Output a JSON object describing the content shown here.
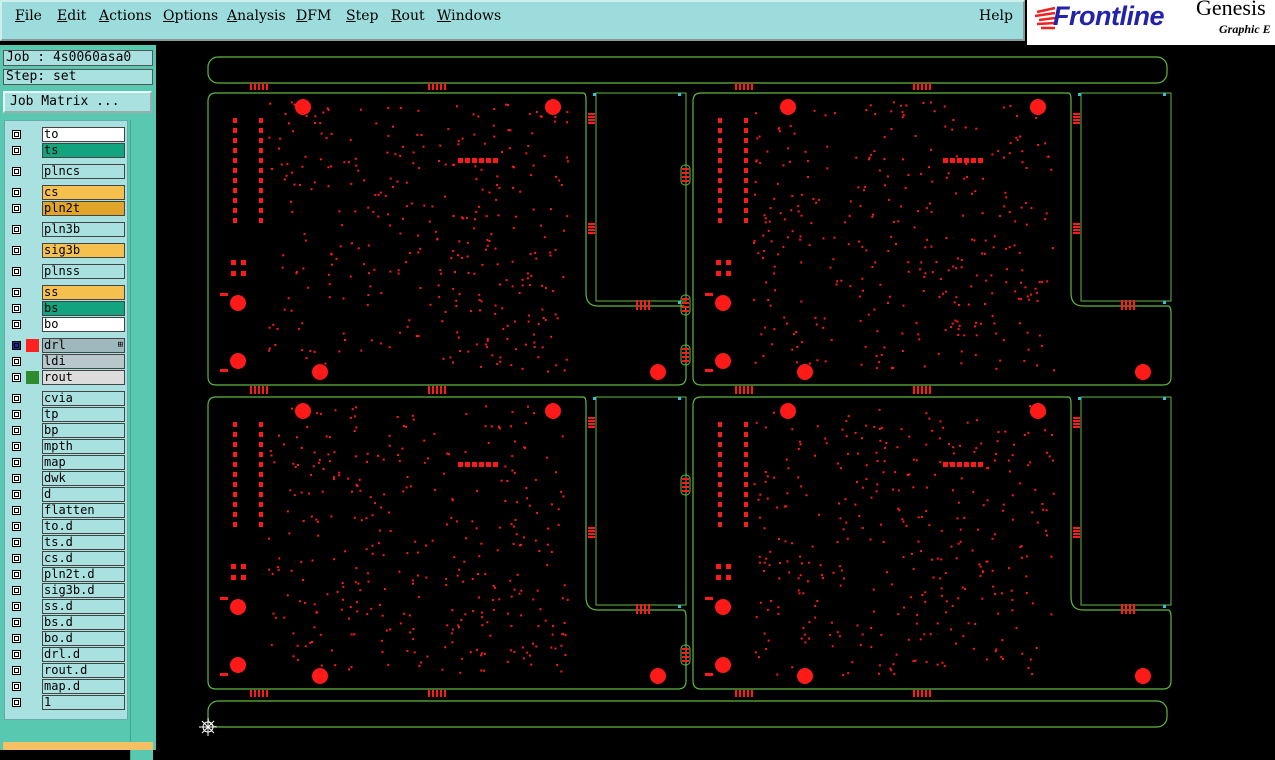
{
  "menu": {
    "items": [
      {
        "label": "File",
        "key": "F",
        "rest": "ile"
      },
      {
        "label": "Edit",
        "key": "E",
        "rest": "dit"
      },
      {
        "label": "Actions",
        "key": "A",
        "rest": "ctions"
      },
      {
        "label": "Options",
        "key": "O",
        "rest": "ptions"
      },
      {
        "label": "Analysis",
        "key": "A",
        "rest": "nalysis"
      },
      {
        "label": "DFM",
        "key": "D",
        "rest": "FM"
      },
      {
        "label": "Step",
        "key": "S",
        "rest": "tep"
      },
      {
        "label": "Rout",
        "key": "R",
        "rest": "out"
      },
      {
        "label": "Windows",
        "key": "W",
        "rest": "indows"
      }
    ],
    "help": "Help"
  },
  "logo": {
    "brand": "Frontline",
    "product": "Genesis",
    "subtitle": "Graphic E"
  },
  "job": {
    "label": "Job : 4s0060asa0",
    "step": "Step: set",
    "matrix_button": "Job Matrix ..."
  },
  "layers": [
    {
      "name": "to",
      "color": "#ffffff"
    },
    {
      "name": "ts",
      "color": "#13a37e"
    },
    {
      "name": "plncs",
      "color": "#a9e0e0"
    },
    {
      "name": "cs",
      "color": "#f6c04f"
    },
    {
      "name": "pln2t",
      "color": "#e0a52a"
    },
    {
      "name": "pln3b",
      "color": "#a9e0e0"
    },
    {
      "name": "sig3b",
      "color": "#f6c04f"
    },
    {
      "name": "plnss",
      "color": "#a9e0e0"
    },
    {
      "name": "ss",
      "color": "#f6c04f"
    },
    {
      "name": "bs",
      "color": "#13a37e"
    },
    {
      "name": "bo",
      "color": "#ffffff"
    },
    {
      "name": "drl",
      "color": "#9fb8bc",
      "swatch": "#ff2020",
      "active": true
    },
    {
      "name": "ldi",
      "color": "#b8c8ca"
    },
    {
      "name": "rout",
      "color": "#dcdcdc",
      "swatch": "#2e8b2e"
    },
    {
      "name": "cvia",
      "color": "#a9e0e0"
    },
    {
      "name": "tp",
      "color": "#a9e0e0"
    },
    {
      "name": "bp",
      "color": "#a9e0e0"
    },
    {
      "name": "mpth",
      "color": "#a9e0e0"
    },
    {
      "name": "map",
      "color": "#a9e0e0"
    },
    {
      "name": "dwk",
      "color": "#a9e0e0"
    },
    {
      "name": "d",
      "color": "#a9e0e0"
    },
    {
      "name": "flatten",
      "color": "#a9e0e0"
    },
    {
      "name": "to.d",
      "color": "#a9e0e0"
    },
    {
      "name": "ts.d",
      "color": "#a9e0e0"
    },
    {
      "name": "cs.d",
      "color": "#a9e0e0"
    },
    {
      "name": "pln2t.d",
      "color": "#a9e0e0"
    },
    {
      "name": "sig3b.d",
      "color": "#a9e0e0"
    },
    {
      "name": "ss.d",
      "color": "#a9e0e0"
    },
    {
      "name": "bs.d",
      "color": "#a9e0e0"
    },
    {
      "name": "bo.d",
      "color": "#a9e0e0"
    },
    {
      "name": "drl.d",
      "color": "#a9e0e0"
    },
    {
      "name": "rout.d",
      "color": "#a9e0e0"
    },
    {
      "name": "map.d",
      "color": "#a9e0e0"
    },
    {
      "name": "1",
      "color": "#a9e0e0"
    }
  ],
  "colors": {
    "board_outline": "#5fb83c",
    "drill": "#ff1a1a",
    "fiducial": "#30c0e0",
    "panel_bg": "#9ddcdc"
  }
}
